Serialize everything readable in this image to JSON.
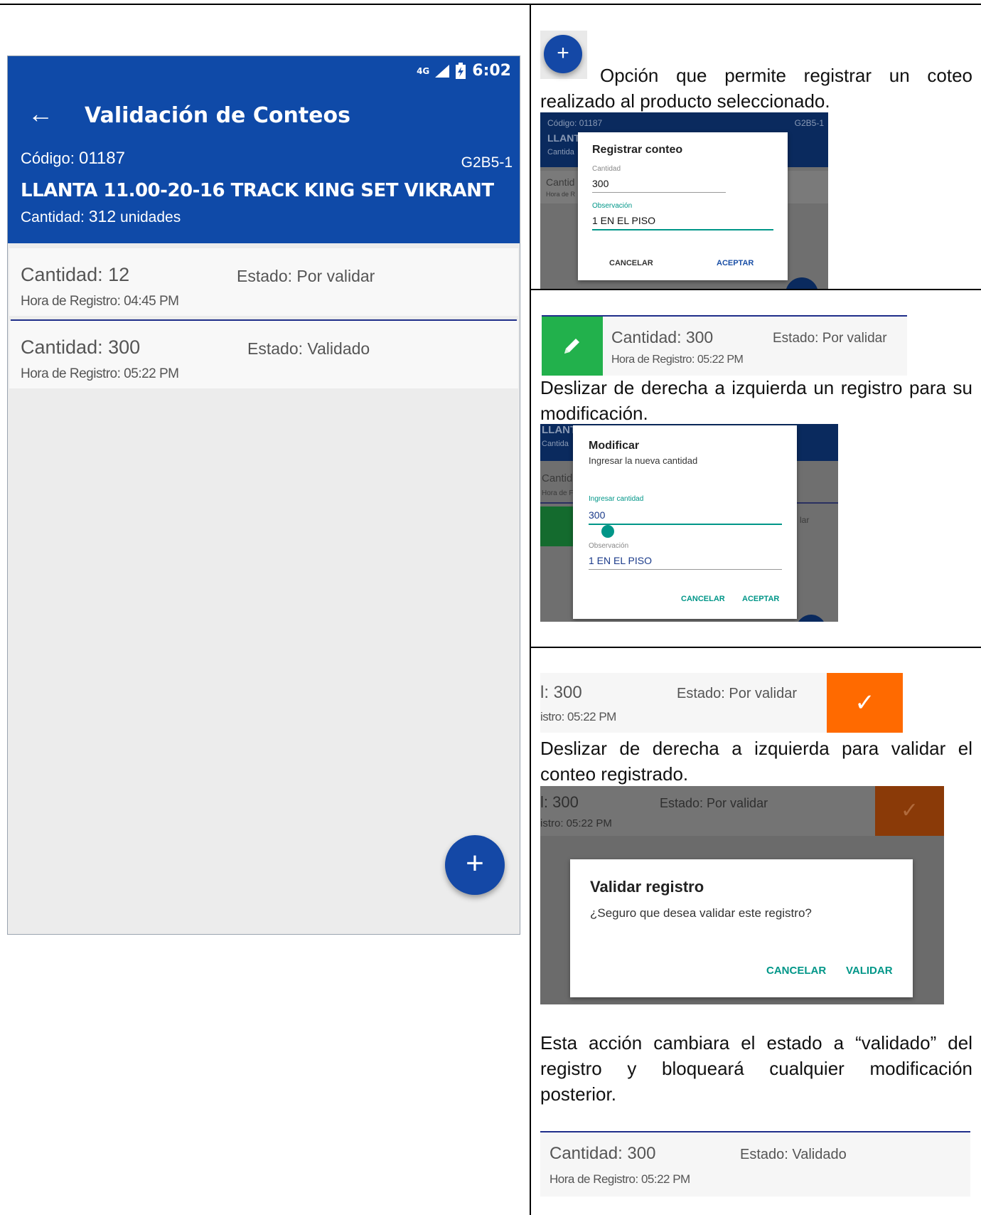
{
  "phone": {
    "status_time": "6:02",
    "status_net": "4G",
    "title": "Validación de Conteos",
    "code_label": "Código:",
    "code_value": "01187",
    "location": "G2B5-1",
    "product": "LLANTA 11.00-20-16 TRACK KING SET VIKRANT",
    "qty_label": "Cantidad:",
    "qty_value": "312",
    "qty_unit": "unidades",
    "records": [
      {
        "cantidad": "Cantidad: 12",
        "estado": "Estado: Por validar",
        "hora": "Hora de Registro: 04:45 PM"
      },
      {
        "cantidad": "Cantidad: 300",
        "estado": "Estado: Validado",
        "hora": "Hora de Registro: 05:22 PM"
      }
    ],
    "fab_symbol": "+"
  },
  "section1": {
    "fab_symbol": "+",
    "text": "Opción que permite registrar un coteo realizado al producto seleccionado.",
    "bg_code": "Código: 01187",
    "bg_loc": "G2B5-1",
    "bg_product": "LLANT",
    "bg_qty": "Cantida",
    "bg_row": "Cantid",
    "bg_hora": "Hora de R",
    "dialog": {
      "title": "Registrar conteo",
      "field1_label": "Cantidad",
      "field1_value": "300",
      "field2_label": "Observación",
      "field2_value": "1 EN EL PISO",
      "cancel": "CANCELAR",
      "accept": "ACEPTAR"
    }
  },
  "section2": {
    "row": {
      "cantidad": "Cantidad: 300",
      "estado": "Estado: Por validar",
      "hora": "Hora de Registro: 05:22 PM"
    },
    "text": "Deslizar de derecha a izquierda un registro para su modificación.",
    "bg_product": "LLANT",
    "bg_qty": "Cantida",
    "bg_row": "Cantid",
    "bg_hora": "Hora de F",
    "bg_estado": "lar",
    "dialog": {
      "title": "Modificar",
      "subtitle": "Ingresar la nueva cantidad",
      "field1_label": "Ingresar cantidad",
      "field1_value": "300",
      "field2_label": "Observación",
      "field2_value": "1 EN EL PISO",
      "cancel": "CANCELAR",
      "accept": "ACEPTAR"
    }
  },
  "section3": {
    "row": {
      "cantidad": "l: 300",
      "estado": "Estado: Por validar",
      "hora": "istro: 05:22 PM"
    },
    "check": "✓",
    "text": "Deslizar de derecha a izquierda para validar el conteo registrado.",
    "dialog": {
      "title": "Validar registro",
      "message": "¿Seguro que desea validar este registro?",
      "cancel": "CANCELAR",
      "accept": "VALIDAR"
    },
    "text2": "Esta acción cambiara el estado a “validado” del registro y bloqueará cualquier modificación posterior.",
    "final_row": {
      "cantidad": "Cantidad: 300",
      "estado": "Estado: Validado",
      "hora": "Hora de Registro: 05:22 PM"
    }
  },
  "colors": {
    "primary": "#0f4aa8",
    "green": "#22b14c",
    "orange": "#ff6a00",
    "teal": "#009688"
  }
}
